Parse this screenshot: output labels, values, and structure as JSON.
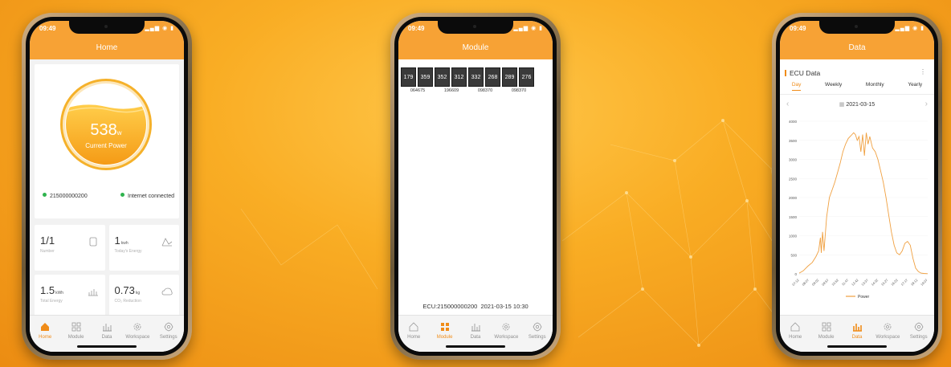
{
  "phones": [
    {
      "time": "09:49",
      "header": "Home",
      "current_power": "538",
      "current_power_unit": "w",
      "current_power_label": "Current Power",
      "ecu_id": "215000000200",
      "internet_status": "Internet connected",
      "stats": [
        {
          "value": "1/1",
          "unit": "",
          "label": "Number",
          "icon": "microinverter-icon"
        },
        {
          "value": "1",
          "unit": "kwh",
          "label": "Today's Energy",
          "icon": "energy-chart-icon"
        },
        {
          "value": "1.5",
          "unit": "kWh",
          "label": "Total Energy",
          "icon": "bar-chart-icon"
        },
        {
          "value": "0.73",
          "unit": "kg",
          "label": "CO₂ Reduction",
          "icon": "leaf-cloud-icon"
        }
      ]
    },
    {
      "time": "09:49",
      "header": "Module",
      "module_values": [
        "179",
        "359",
        "352",
        "312",
        "332",
        "268",
        "289",
        "276"
      ],
      "module_ids": [
        "064675",
        "196609",
        "098370",
        "098370"
      ],
      "footer_ecu": "ECU:215000000200",
      "footer_datetime": "2021-03-15 10:30"
    },
    {
      "time": "09:49",
      "header": "Data",
      "title": "ECU Data",
      "period_tabs": [
        "Day",
        "Weekly",
        "Monthly",
        "Yearly"
      ],
      "active_period": "Day",
      "date": "2021-03-15"
    }
  ],
  "tabbar": [
    "Home",
    "Module",
    "Data",
    "Workspace",
    "Settings"
  ],
  "colors": {
    "accent": "#f7a235",
    "active_tab": "#f08c18",
    "online_dot": "#2fb34e",
    "line": "#f0a040"
  },
  "chart_data": {
    "type": "line",
    "title": "",
    "xlabel": "",
    "ylabel": "",
    "ylim": [
      0,
      4000
    ],
    "y_ticks": [
      "0",
      "500",
      "1000",
      "1500",
      "2000",
      "2500",
      "3000",
      "3500",
      "4000"
    ],
    "x_ticks": [
      "07:12",
      "08:07",
      "09:02",
      "09:57",
      "10:52",
      "11:47",
      "12:42",
      "13:37",
      "14:32",
      "15:27",
      "16:22",
      "17:17",
      "18:12",
      "19:07"
    ],
    "legend": [
      "Power"
    ],
    "series": [
      {
        "name": "Power",
        "x": [
          "07:12",
          "07:35",
          "08:00",
          "08:25",
          "08:45",
          "09:00",
          "09:10",
          "09:15",
          "09:22",
          "09:30",
          "09:45",
          "10:00",
          "10:15",
          "10:30",
          "10:45",
          "11:00",
          "11:15",
          "11:30",
          "11:45",
          "12:00",
          "12:15",
          "12:25",
          "12:35",
          "12:45",
          "12:55",
          "13:05",
          "13:15",
          "13:25",
          "13:35",
          "13:45",
          "14:00",
          "14:15",
          "14:30",
          "14:45",
          "15:00",
          "15:15",
          "15:30",
          "15:45",
          "16:00",
          "16:15",
          "16:30",
          "16:45",
          "17:00",
          "17:15",
          "17:30",
          "17:45",
          "18:00",
          "18:15",
          "18:30",
          "18:45",
          "19:07"
        ],
        "values": [
          20,
          80,
          200,
          300,
          450,
          600,
          950,
          550,
          1100,
          600,
          1500,
          2000,
          2200,
          2400,
          2650,
          2900,
          3200,
          3400,
          3550,
          3620,
          3700,
          3650,
          3500,
          3600,
          3200,
          3650,
          3100,
          3700,
          3400,
          3600,
          3300,
          3200,
          3000,
          2700,
          2400,
          2000,
          1550,
          1100,
          750,
          550,
          500,
          600,
          800,
          850,
          750,
          400,
          150,
          60,
          20,
          10,
          5
        ]
      }
    ]
  }
}
